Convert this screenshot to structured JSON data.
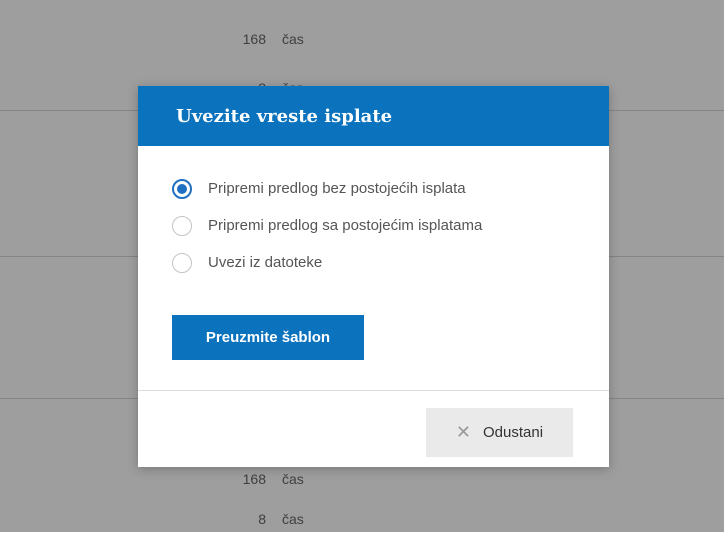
{
  "background": {
    "rows": [
      {
        "value": "168",
        "unit": "čas"
      },
      {
        "value": "8",
        "unit": "čas"
      },
      {
        "value": "168",
        "unit": "čas"
      },
      {
        "value": "8",
        "unit": "čas"
      }
    ]
  },
  "modal": {
    "title": "Uvezite vreste isplate",
    "options": [
      {
        "label": "Pripremi predlog bez postojećih isplata",
        "checked": true
      },
      {
        "label": "Pripremi predlog sa postojećim isplatama",
        "checked": false
      },
      {
        "label": "Uvezi iz datoteke",
        "checked": false
      }
    ],
    "download_template_label": "Preuzmite šablon",
    "cancel_label": "Odustani",
    "cancel_icon": "close-icon"
  },
  "colors": {
    "accent": "#0b72be",
    "radio_accent": "#1f6fc2",
    "cancel_bg": "#eaeaea"
  }
}
